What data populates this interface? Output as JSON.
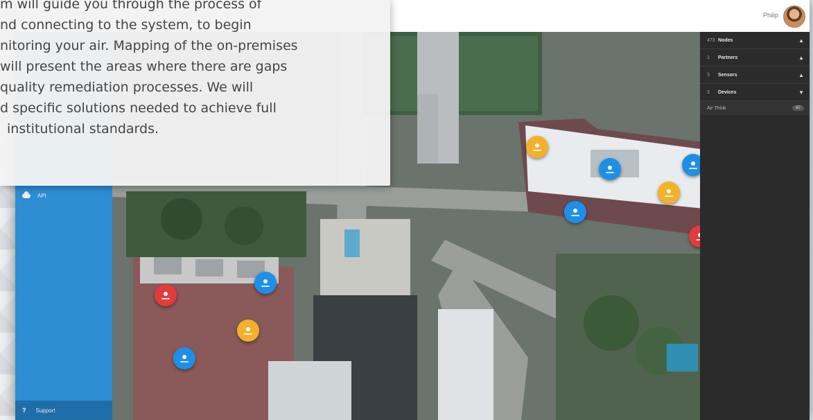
{
  "header": {
    "user_name": "Philip"
  },
  "overlay": {
    "lines": [
      "m will guide you through the process of",
      "nd connecting to the system, to begin",
      "nitoring your air. Mapping of the on-premises",
      "will present the areas where there are gaps",
      "quality remediation processes. We will",
      "d specific solutions needed to achieve full",
      "institutional standards."
    ]
  },
  "sidebar": {
    "items": [
      {
        "label": "API",
        "icon": "cloud-icon"
      }
    ],
    "support": {
      "label": "Support",
      "icon": "help-icon",
      "glyph": "?"
    }
  },
  "right_panel": {
    "sections": [
      {
        "num": "473",
        "label": "Nodes",
        "state": "expanded"
      },
      {
        "num": "1",
        "label": "Partners",
        "state": "expanded"
      },
      {
        "num": "3",
        "label": "Sensors",
        "state": "expanded"
      },
      {
        "num": "3",
        "label": "Devices",
        "state": "collapsed"
      }
    ],
    "sub_item": {
      "label": "Air Think",
      "count": "87"
    }
  },
  "colors": {
    "sidebar": "#2d8ed3",
    "marker_blue": "#1e8fe8",
    "marker_orange": "#f3b12a",
    "marker_red": "#e33b3b"
  }
}
